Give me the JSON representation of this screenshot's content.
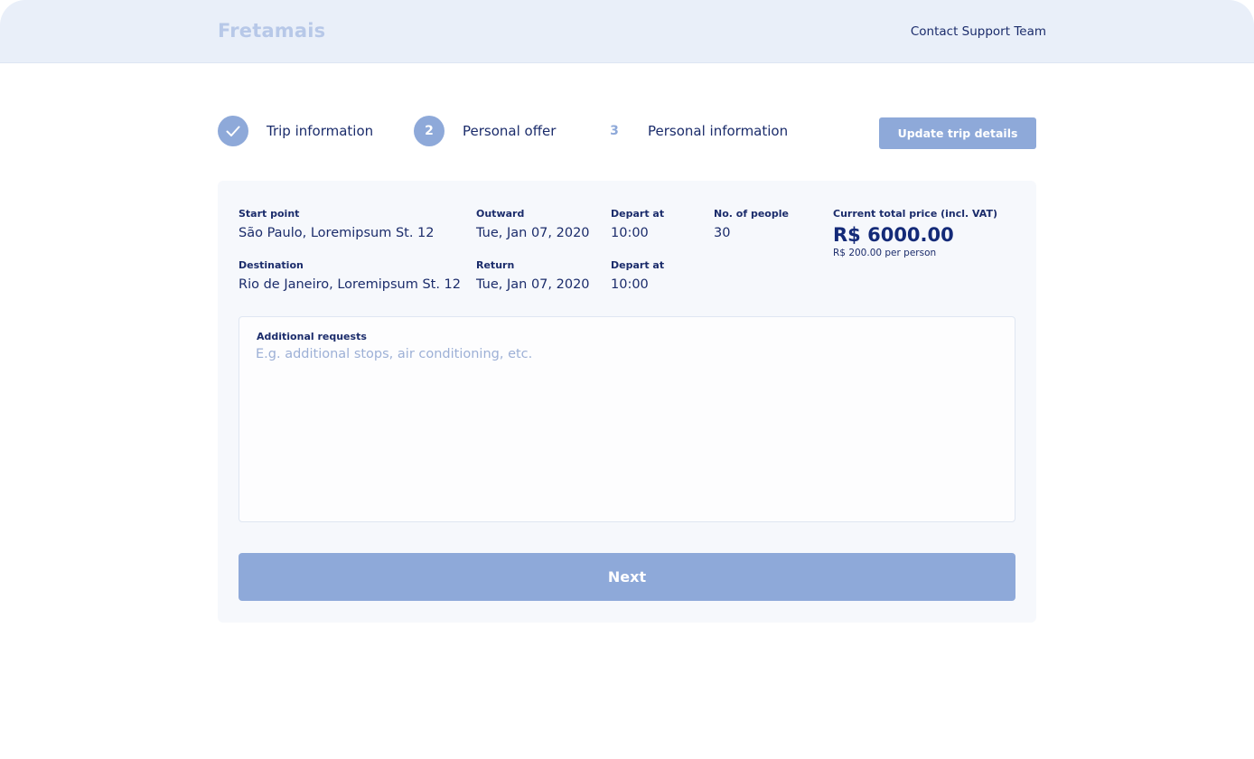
{
  "header": {
    "logo": "Fretamais",
    "support_link": "Contact Support Team"
  },
  "steps": [
    {
      "number": "",
      "label": "Trip information",
      "status": "completed",
      "icon": "check-icon"
    },
    {
      "number": "2",
      "label": "Personal offer",
      "status": "active"
    },
    {
      "number": "3",
      "label": "Personal information",
      "status": "upcoming"
    }
  ],
  "update_button": "Update trip details",
  "trip": {
    "start_point": {
      "label": "Start point",
      "value": "São Paulo, Loremipsum St. 12"
    },
    "destination": {
      "label": "Destination",
      "value": "Rio de Janeiro, Loremipsum St. 12"
    },
    "outward": {
      "label": "Outward",
      "value": "Tue, Jan 07, 2020"
    },
    "return": {
      "label": "Return",
      "value": "Tue, Jan 07, 2020"
    },
    "outward_depart": {
      "label": "Depart at",
      "value": "10:00"
    },
    "return_depart": {
      "label": "Depart at",
      "value": "10:00"
    },
    "people": {
      "label": "No. of people",
      "value": "30"
    },
    "price": {
      "label": "Current total price (incl. VAT)",
      "value": "R$ 6000.00",
      "per_person": "R$ 200.00 per person"
    }
  },
  "requests": {
    "label": "Additional requests",
    "value": "",
    "placeholder": "E.g. additional stops, air conditioning, etc."
  },
  "next_button": "Next",
  "colors": {
    "accent": "#8ea9d9",
    "text": "#1b2c6b",
    "header_bg": "#e9eff9",
    "card_bg": "#f6f8fc"
  }
}
